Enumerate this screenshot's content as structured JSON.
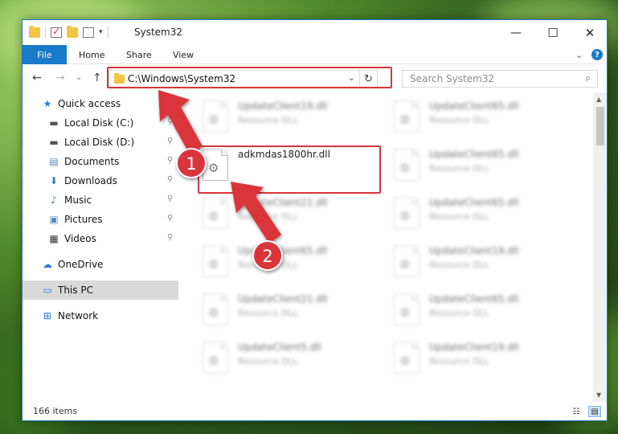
{
  "window": {
    "title": "System32"
  },
  "title_controls": {
    "minimize": "—",
    "maximize": "☐",
    "close": "✕"
  },
  "ribbon": {
    "tabs": [
      "File",
      "Home",
      "Share",
      "View"
    ],
    "collapse": "⌄",
    "help": "?"
  },
  "nav": {
    "back": "←",
    "forward": "→",
    "recent": "⌄",
    "up": "↑",
    "address": "C:\\Windows\\System32",
    "address_dropdown": "⌄",
    "refresh": "↻",
    "search_placeholder": "Search System32"
  },
  "sidebar": {
    "items": [
      {
        "label": "Quick access",
        "icon": "star-icon",
        "glyph": "★",
        "color": "#2f7bd8",
        "pinned": false
      },
      {
        "label": "Local Disk (C:)",
        "icon": "drive-icon",
        "glyph": "▬",
        "color": "#555555",
        "pinned": true
      },
      {
        "label": "Local Disk (D:)",
        "icon": "drive-icon",
        "glyph": "▬",
        "color": "#555555",
        "pinned": true
      },
      {
        "label": "Documents",
        "icon": "documents-icon",
        "glyph": "▤",
        "color": "#5a7fb0",
        "pinned": true
      },
      {
        "label": "Downloads",
        "icon": "download-arrow-icon",
        "glyph": "⬇",
        "color": "#2a7ad6",
        "pinned": true
      },
      {
        "label": "Music",
        "icon": "music-note-icon",
        "glyph": "♪",
        "color": "#2a7ad6",
        "pinned": true
      },
      {
        "label": "Pictures",
        "icon": "pictures-icon",
        "glyph": "▣",
        "color": "#4a8fc9",
        "pinned": true
      },
      {
        "label": "Videos",
        "icon": "film-icon",
        "glyph": "▦",
        "color": "#333333",
        "pinned": true
      },
      {
        "label": "OneDrive",
        "icon": "cloud-icon",
        "glyph": "☁",
        "color": "#2a7ad6",
        "pinned": false
      },
      {
        "label": "This PC",
        "icon": "monitor-icon",
        "glyph": "▭",
        "color": "#2a7ad6",
        "pinned": false
      },
      {
        "label": "Network",
        "icon": "network-icon",
        "glyph": "⊞",
        "color": "#2a7ad6",
        "pinned": false
      }
    ],
    "pin_glyph": "📌"
  },
  "files": {
    "left": [
      {
        "name": "UpdateClient19.dll",
        "type": "Resource DLL"
      },
      {
        "name": "adkmdas1800hr.dll",
        "type": ""
      },
      {
        "name": "UpdateClient21.dll",
        "type": "Resource DLL"
      },
      {
        "name": "UpdateClient65.dll",
        "type": "Resource DLL"
      },
      {
        "name": "UpdateClient21.dll",
        "type": "Resource DLL"
      },
      {
        "name": "UpdateClient5.dll",
        "type": "Resource DLL"
      }
    ],
    "right": [
      {
        "name": "UpdateClient65.dll",
        "type": "Resource DLL"
      },
      {
        "name": "UpdateClient65.dll",
        "type": "Resource DLL"
      },
      {
        "name": "UpdateClient65.dll",
        "type": "Resource DLL"
      },
      {
        "name": "UpdateClient19.dll",
        "type": "Resource DLL"
      },
      {
        "name": "UpdateClient65.dll",
        "type": "Resource DLL"
      },
      {
        "name": "UpdateClient19.dll",
        "type": "Resource DLL"
      }
    ]
  },
  "status": {
    "items_count": "166 items"
  },
  "view_buttons": {
    "details": "☷",
    "large_icons": "▤"
  },
  "annotations": [
    {
      "label": "1",
      "color": "#d9343a"
    },
    {
      "label": "2",
      "color": "#d9343a"
    }
  ],
  "colors": {
    "accent": "#1979ca",
    "highlight": "#d9343a"
  }
}
